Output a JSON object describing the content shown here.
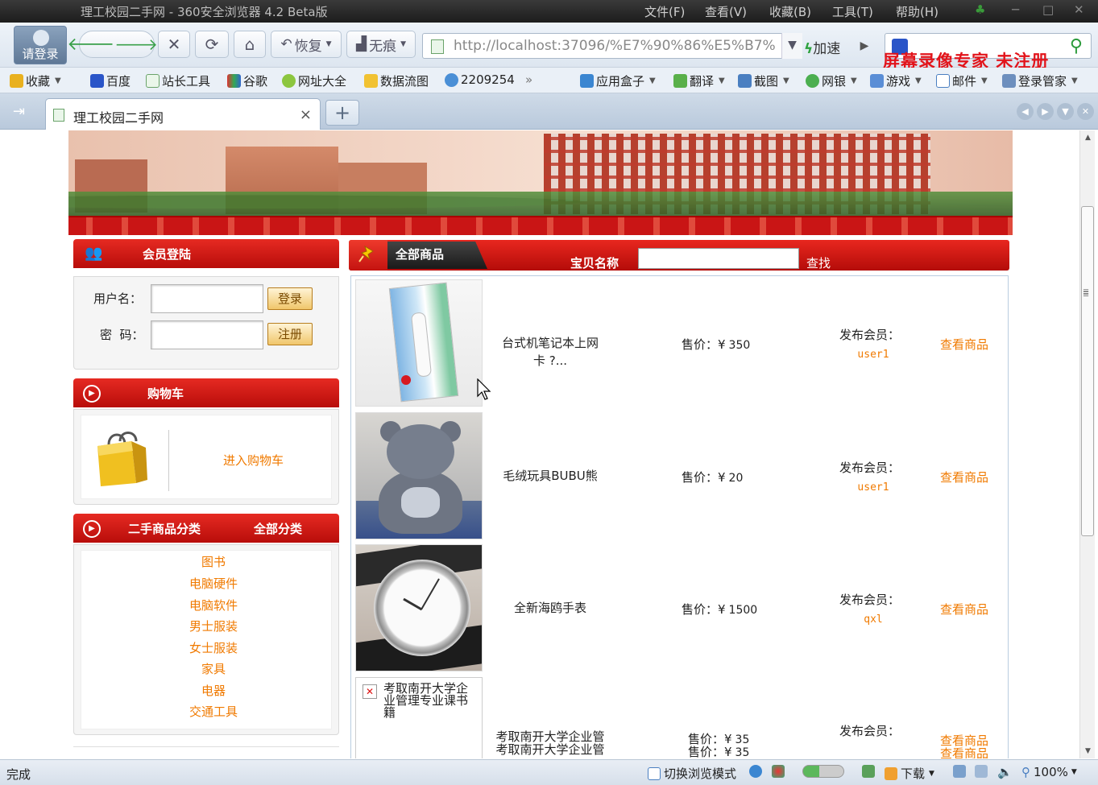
{
  "browser": {
    "window_title": "理工校园二手网 - 360安全浏览器 4.2 Beta版",
    "menu": [
      "文件(F)",
      "查看(V)",
      "收藏(B)",
      "工具(T)",
      "帮助(H)"
    ],
    "account_label": "请登录",
    "restore_label": "恢复",
    "incognito_label": "无痕",
    "url": "http://localhost:37096/%E7%90%86%E5%B7%",
    "speed_label": "加速",
    "watermark": "屏幕录像专家  未注册",
    "favorites": [
      "收藏",
      "百度",
      "站长工具",
      "谷歌",
      "网址大全",
      "数据流图",
      "2209254",
      "应用盒子",
      "翻译",
      "截图",
      "网银",
      "游戏",
      "邮件",
      "登录管家"
    ],
    "tab_title": "理工校园二手网",
    "status_text": "完成",
    "status_items": [
      "切换浏览模式",
      "下载",
      "100%"
    ]
  },
  "login": {
    "header": "会员登陆",
    "username_label": "用户名：",
    "password_label": "密  码：",
    "login_button": "登录",
    "register_button": "注册"
  },
  "cart": {
    "header": "购物车",
    "link": "进入购物车"
  },
  "categories": {
    "header": "二手商品分类",
    "all_link": "全部分类",
    "items": [
      "图书",
      "电脑硬件",
      "电脑软件",
      "男士服装",
      "女士服装",
      "家具",
      "电器",
      "交通工具"
    ]
  },
  "goods": {
    "header": "全部商品",
    "name_label": "宝贝名称",
    "search_button": "查找",
    "price_label": "售价：¥",
    "seller_label": "发布会员：",
    "view_label": "查看商品",
    "items": [
      {
        "title_line1": "台式机笔记本上网",
        "title_line2": "卡 ?...",
        "price": "350",
        "seller": "user1"
      },
      {
        "title_line1": "毛绒玩具BUBU熊",
        "title_line2": "",
        "price": "20",
        "seller": "user1"
      },
      {
        "title_line1": "全新海鸥手表",
        "title_line2": "",
        "price": "1500",
        "seller": "qxl"
      },
      {
        "image_alt": "考取南开大学企业管理专业课书籍",
        "title_line1": "考取南开大学企业管",
        "title_line2": "考取南开大学企业管",
        "price": "35",
        "price2": "35"
      }
    ]
  }
}
